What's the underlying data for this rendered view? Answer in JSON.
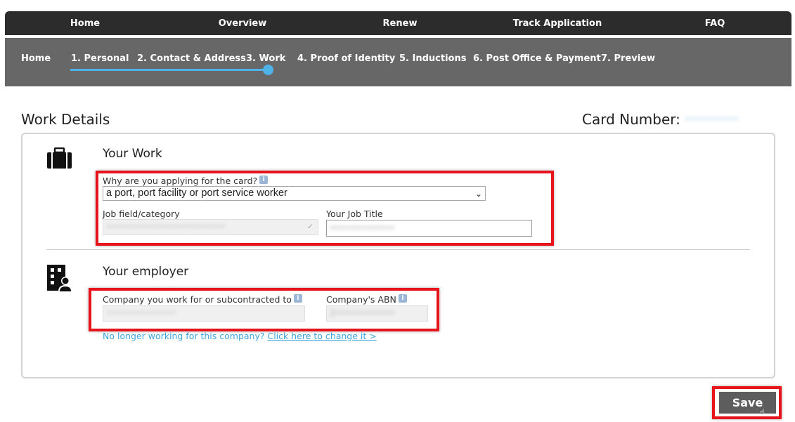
{
  "topnav": {
    "items": [
      "Home",
      "Overview",
      "Renew",
      "Track Application",
      "FAQ"
    ]
  },
  "steps": {
    "items": [
      "Home",
      "1. Personal",
      "2. Contact & Address",
      "3. Work",
      "4. Proof of Identity",
      "5. Inductions",
      "6. Post Office & Payment",
      "7. Preview"
    ],
    "current": "3. Work"
  },
  "page": {
    "title": "Work Details",
    "card_number_label": "Card Number:",
    "card_number_value": "••••••••••"
  },
  "your_work": {
    "title": "Your Work",
    "icon": "briefcase-icon",
    "reason_label": "Why are you applying for the card?",
    "reason_value": "a port, port facility or port service worker",
    "job_field_label": "Job field/category",
    "job_field_value": "••••••••••••••••••••••••",
    "job_title_label": "Your Job Title",
    "job_title_value": "•••••••••••••"
  },
  "your_employer": {
    "title": "Your employer",
    "icon": "building-person-icon",
    "company_label": "Company you work for or subcontracted to",
    "company_value": "••••••••••••••",
    "abn_label": "Company's ABN",
    "abn_value": "2••••••••••••",
    "change_text": "No longer working for this company?",
    "change_link": "Click here to change it >"
  },
  "actions": {
    "save_label": "Save"
  },
  "colors": {
    "accent": "#4fb3e8",
    "highlight": "#e8141c",
    "nav_dark": "#2c2c2c",
    "step_bar": "#676767"
  }
}
